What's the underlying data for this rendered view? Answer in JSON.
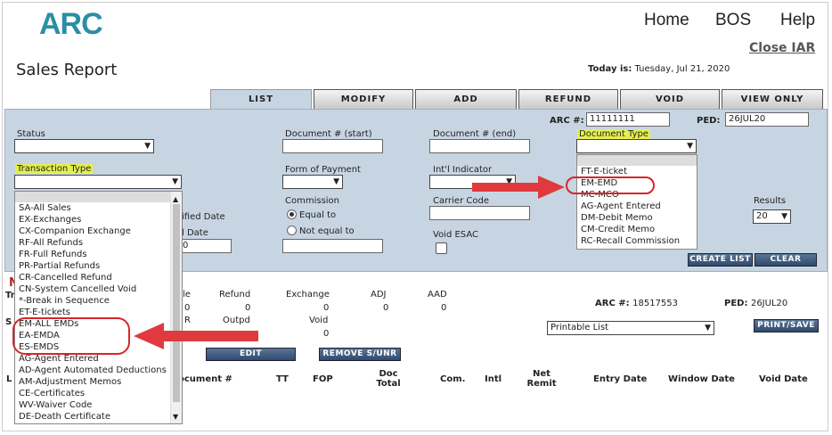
{
  "header": {
    "logo": "ARC",
    "nav": [
      "Home",
      "BOS",
      "Help"
    ],
    "close_iar": "Close IAR",
    "page_title": "Sales Report",
    "today_label": "Today is:",
    "today_value": "Tuesday, Jul 21, 2020"
  },
  "tabs": [
    "LIST",
    "MODIFY",
    "ADD",
    "REFUND",
    "VOID",
    "VIEW ONLY"
  ],
  "filters": {
    "arc_label": "ARC #:",
    "arc_value": "11111111",
    "ped_label": "PED:",
    "ped_value": "26JUL20",
    "status_label": "Status",
    "doc_start_label": "Document # (start)",
    "doc_end_label": "Document # (end)",
    "doc_type_label": "Document Type",
    "trans_type_label": "Transaction Type",
    "fop_label": "Form of Payment",
    "intl_label": "Int'l Indicator",
    "commission_label": "Commission",
    "equal_to": "Equal to",
    "not_equal_to": "Not equal to",
    "carrier_label": "Carrier Code",
    "void_esac_label": "Void ESAC",
    "modified_label": "ified Date",
    "date_label": "l Date",
    "date_value": "0",
    "results_label": "Results",
    "results_value": "20",
    "create_list": "CREATE LIST",
    "clear": "CLEAR"
  },
  "doc_type_options": [
    "FT-E-ticket",
    "EM-EMD",
    "MC-MCO",
    "AG-Agent Entered",
    "DM-Debit Memo",
    "CM-Credit Memo",
    "RC-Recall Commission"
  ],
  "trans_type_options": [
    "SA-All Sales",
    "EX-Exchanges",
    "CX-Companion Exchange",
    "RF-All Refunds",
    "FR-Full Refunds",
    "PR-Partial Refunds",
    "CR-Cancelled Refund",
    "CN-System Cancelled Void",
    "*-Break in Sequence",
    "ET-E-tickets",
    "EM-ALL EMDs",
    "EA-EMDA",
    "ES-EMDS",
    "AG-Agent Entered",
    "AD-Agent Automated Deductions",
    "AM-Adjustment Memos",
    "CE-Certificates",
    "WV-Waiver Code",
    "DE-Death Certificate"
  ],
  "summary": {
    "headers": [
      "le",
      "Refund",
      "Exchange",
      "ADJ",
      "AAD"
    ],
    "values": [
      "0",
      "0",
      "0",
      "0",
      "0"
    ],
    "row2_headers": [
      "R",
      "Outpd",
      "Void"
    ],
    "row2_values": [
      "0"
    ],
    "arc_label": "ARC #:",
    "arc_value": "18517553",
    "ped_label": "PED:",
    "ped_value": "26JUL20",
    "printable": "Printable List",
    "print_save": "PRINT/SAVE",
    "edit_commission": "EDIT COMMISSION",
    "remove_sunr": "REMOVE S/UNR",
    "partial_n": "N",
    "partial_tr": "Tr",
    "partial_s": "S",
    "partial_l": "L"
  },
  "columns": [
    "ocument #",
    "TT",
    "FOP",
    "Doc Total",
    "Com.",
    "Intl",
    "Net Remit",
    "Entry Date",
    "Window Date",
    "Void Date"
  ],
  "colors": {
    "logo": "#2a8fa3",
    "panel": "#c7d5e3",
    "highlight": "#e3ef4e",
    "arrow": "#e03a3e"
  }
}
